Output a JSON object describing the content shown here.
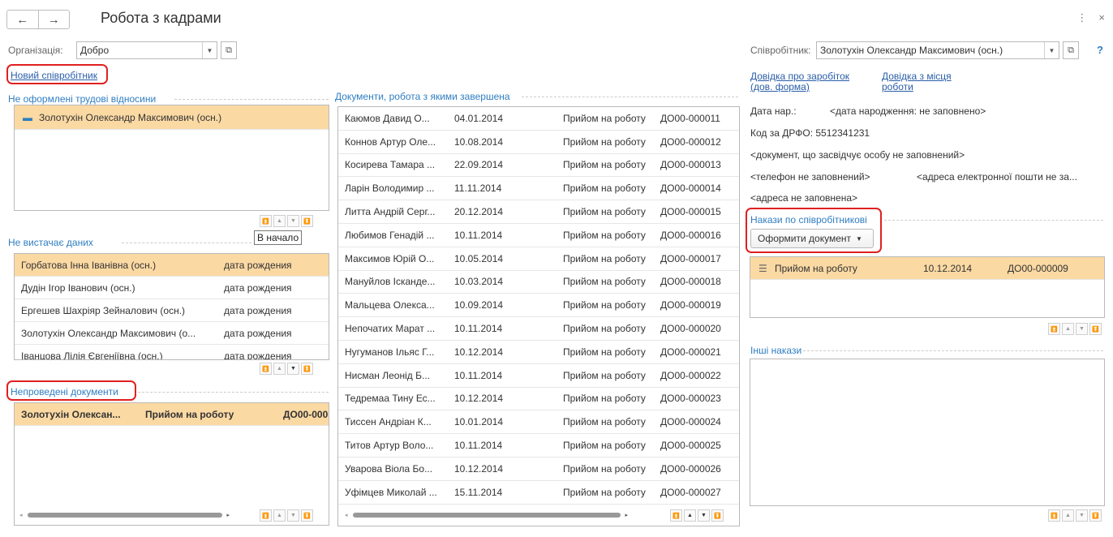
{
  "header": {
    "title": "Робота з кадрами",
    "back_icon": "←",
    "forward_icon": "→",
    "menu_icon": "⋮",
    "close_icon": "×"
  },
  "organization": {
    "label": "Організація:",
    "value": "Добро"
  },
  "new_employee_link": "Новий співробітник",
  "unregistered": {
    "title": "Не оформлені трудові відносини",
    "items": [
      {
        "name": "Золотухін Олександр Максимович (осн.)"
      }
    ]
  },
  "tooltip": "В начало",
  "missing_data": {
    "title": "Не вистачає даних",
    "rows": [
      {
        "name": "Горбатова Інна Іванівна (осн.)",
        "field": "дата рождения"
      },
      {
        "name": "Дудін Ігор Іванович (осн.)",
        "field": "дата рождения"
      },
      {
        "name": "Ергешев Шахріяр Зейналович (осн.)",
        "field": "дата рождения"
      },
      {
        "name": "Золотухін Олександр Максимович (о...",
        "field": "дата рождения"
      },
      {
        "name": "Іванцова Лілія Євгеніївна (осн.)",
        "field": "дата рождения"
      }
    ]
  },
  "unposted": {
    "title": "Непроведені документи",
    "row": {
      "name": "Золотухін Олексан...",
      "doc": "Прийом на роботу",
      "num": "ДО00-000"
    }
  },
  "completed": {
    "title": "Документи, робота з якими завершена",
    "rows": [
      {
        "name": "Каюмов Давид О...",
        "date": "04.01.2014",
        "doc": "Прийом на роботу",
        "num": "ДО00-000011"
      },
      {
        "name": "Коннов Артур Оле...",
        "date": "10.08.2014",
        "doc": "Прийом на роботу",
        "num": "ДО00-000012"
      },
      {
        "name": "Косирева Тамара ...",
        "date": "22.09.2014",
        "doc": "Прийом на роботу",
        "num": "ДО00-000013"
      },
      {
        "name": "Ларін Володимир ...",
        "date": "11.11.2014",
        "doc": "Прийом на роботу",
        "num": "ДО00-000014"
      },
      {
        "name": "Литта Андрій Серг...",
        "date": "20.12.2014",
        "doc": "Прийом на роботу",
        "num": "ДО00-000015"
      },
      {
        "name": "Любимов Генадій ...",
        "date": "10.11.2014",
        "doc": "Прийом на роботу",
        "num": "ДО00-000016"
      },
      {
        "name": "Максимов Юрій О...",
        "date": "10.05.2014",
        "doc": "Прийом на роботу",
        "num": "ДО00-000017"
      },
      {
        "name": "Мануйлов Іскандe...",
        "date": "10.03.2014",
        "doc": "Прийом на роботу",
        "num": "ДО00-000018"
      },
      {
        "name": "Мальцева Олекса...",
        "date": "10.09.2014",
        "doc": "Прийом на роботу",
        "num": "ДО00-000019"
      },
      {
        "name": "Непочатих Марат ...",
        "date": "10.11.2014",
        "doc": "Прийом на роботу",
        "num": "ДО00-000020"
      },
      {
        "name": "Нугуманов Ільяс Г...",
        "date": "10.12.2014",
        "doc": "Прийом на роботу",
        "num": "ДО00-000021"
      },
      {
        "name": "Нисман Леонід Б...",
        "date": "10.11.2014",
        "doc": "Прийом на роботу",
        "num": "ДО00-000022"
      },
      {
        "name": "Тедремаа Тину Ес...",
        "date": "10.12.2014",
        "doc": "Прийом на роботу",
        "num": "ДО00-000023"
      },
      {
        "name": "Тиссен Андріан К...",
        "date": "10.01.2014",
        "doc": "Прийом на роботу",
        "num": "ДО00-000024"
      },
      {
        "name": "Титов Артур Воло...",
        "date": "10.11.2014",
        "doc": "Прийом на роботу",
        "num": "ДО00-000025"
      },
      {
        "name": "Уварова Віола Бо...",
        "date": "10.12.2014",
        "doc": "Прийом на роботу",
        "num": "ДО00-000026"
      },
      {
        "name": "Уфімцев Миколай ...",
        "date": "15.11.2014",
        "doc": "Прийом на роботу",
        "num": "ДО00-000027"
      }
    ]
  },
  "employee": {
    "label": "Співробітник:",
    "value": "Золотухін Олександр Максимович (осн.)",
    "help": "?",
    "salary_link_1": "Довідка про заробіток",
    "salary_link_2": "(дов. форма)",
    "work_link_1": "Довідка з місця",
    "work_link_2": "роботи",
    "birth_label": "Дата нар.:",
    "birth_value": "<дата народження: не заповнено>",
    "tax_id": "Код за ДРФО: 5512341231",
    "id_doc": "<документ, що засвідчує особу не заповнений>",
    "phone": "<телефон не заповнений>",
    "email": "<адреса електронної пошти не за...",
    "address": "<адреса не заповнена>"
  },
  "orders": {
    "title": "Накази по співробітникові",
    "button": "Оформити документ",
    "row": {
      "doc": "Прийом на роботу",
      "date": "10.12.2014",
      "num": "ДО00-000009"
    }
  },
  "other_orders": {
    "title": "Інші накази"
  },
  "accent": "#fbd9a3",
  "highlight_color": "#e02020"
}
